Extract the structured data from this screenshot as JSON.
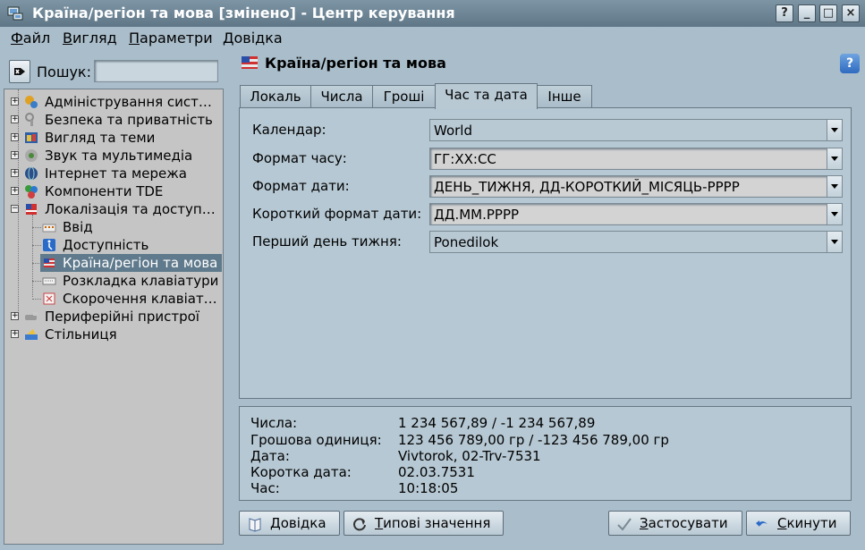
{
  "window": {
    "title": "Країна/регіон та мова [змінено] - Центр керування",
    "buttons": [
      "?",
      "_",
      "□",
      "×"
    ]
  },
  "menubar": {
    "items": [
      {
        "first": "Ф",
        "rest": "айл"
      },
      {
        "first": "В",
        "rest": "игляд"
      },
      {
        "first": "П",
        "rest": "араметри"
      },
      {
        "first": "Д",
        "rest": "овідка"
      }
    ]
  },
  "search": {
    "label": "Пошук:",
    "value": ""
  },
  "tree": {
    "items": [
      {
        "label": "Адміністрування сист…",
        "icon": "admin-icon"
      },
      {
        "label": "Безпека та приватність",
        "icon": "security-icon"
      },
      {
        "label": "Вигляд та теми",
        "icon": "appearance-icon"
      },
      {
        "label": "Звук та мультимедіа",
        "icon": "sound-icon"
      },
      {
        "label": "Інтернет та мережа",
        "icon": "network-icon"
      },
      {
        "label": "Компоненти TDE",
        "icon": "components-icon"
      },
      {
        "label": "Локалізація та доступ…",
        "icon": "localization-icon"
      },
      {
        "label": "Ввід",
        "icon": "input-icon"
      },
      {
        "label": "Доступність",
        "icon": "accessibility-icon"
      },
      {
        "label": "Країна/регіон та мова",
        "icon": "flag-icon"
      },
      {
        "label": "Розкладка клавіатури",
        "icon": "keyboard-icon"
      },
      {
        "label": "Скорочення клавіат…",
        "icon": "shortcuts-icon"
      },
      {
        "label": "Периферійні пристрої",
        "icon": "peripherals-icon"
      },
      {
        "label": "Стільниця",
        "icon": "desktop-icon"
      }
    ]
  },
  "module": {
    "title": "Країна/регіон та мова"
  },
  "tabs": [
    "Локаль",
    "Числа",
    "Гроші",
    "Час та дата",
    "Інше"
  ],
  "form": {
    "calendar": {
      "label": "Календар:",
      "value": "World"
    },
    "time_format": {
      "label": "Формат часу:",
      "value": "ГГ:ХХ:СС"
    },
    "date_format": {
      "label": "Формат дати:",
      "value": "ДЕНЬ_ТИЖНЯ, ДД-КОРОТКИЙ_МІСЯЦЬ-РРРР"
    },
    "short_date_format": {
      "label": "Короткий формат дати:",
      "value": "ДД.ММ.РРРР"
    },
    "first_weekday": {
      "label": "Перший день тижня:",
      "value": "Ponedilok"
    }
  },
  "preview": {
    "rows": [
      {
        "label": "Числа:",
        "value": "1 234 567,89 / -1 234 567,89"
      },
      {
        "label": "Грошова одиниця:",
        "value": "123 456 789,00 гр / -123 456 789,00 гр"
      },
      {
        "label": "Дата:",
        "value": "Vivtorok, 02-Trv-7531"
      },
      {
        "label": "Коротка дата:",
        "value": "02.03.7531"
      },
      {
        "label": "Час:",
        "value": "10:18:05"
      }
    ]
  },
  "buttons": {
    "help": {
      "first": "Д",
      "rest": "овідка"
    },
    "defaults": {
      "first": "Т",
      "rest": "ипові значення"
    },
    "apply": {
      "first": "З",
      "rest": "астосувати"
    },
    "reset": {
      "first": "С",
      "rest": "кинути"
    }
  }
}
